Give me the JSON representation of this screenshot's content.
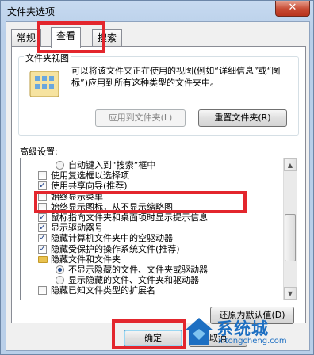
{
  "window": {
    "title": "文件夹选项",
    "close_glyph": "✕"
  },
  "tabs": [
    {
      "label": "常规",
      "active": false
    },
    {
      "label": "查看",
      "active": true
    },
    {
      "label": "搜索",
      "active": false
    }
  ],
  "folder_views": {
    "legend": "文件夹视图",
    "description": "可以将该文件夹正在使用的视图(例如“详细信息”或“图标”)应用到所有这种类型的文件夹中。",
    "apply_button": "应用到文件夹(L)",
    "reset_button": "重置文件夹(R)"
  },
  "advanced": {
    "label": "高级设置:",
    "items": [
      {
        "type": "radio",
        "checked": false,
        "indent": 2,
        "text": "自动键入到“搜索”框中"
      },
      {
        "type": "checkbox",
        "checked": false,
        "indent": 1,
        "text": "使用复选框以选择项"
      },
      {
        "type": "checkbox",
        "checked": true,
        "indent": 1,
        "text": "使用共享向导(推荐)"
      },
      {
        "type": "checkbox",
        "checked": false,
        "indent": 1,
        "text": "始终显示菜单"
      },
      {
        "type": "checkbox",
        "checked": false,
        "indent": 1,
        "text": "始终显示图标，从不显示缩略图"
      },
      {
        "type": "checkbox",
        "checked": true,
        "indent": 1,
        "text": "鼠标指向文件夹和桌面项时显示提示信息"
      },
      {
        "type": "checkbox",
        "checked": true,
        "indent": 1,
        "text": "显示驱动器号"
      },
      {
        "type": "checkbox",
        "checked": true,
        "indent": 1,
        "text": "隐藏计算机文件夹中的空驱动器"
      },
      {
        "type": "checkbox",
        "checked": true,
        "indent": 1,
        "text": "隐藏受保护的操作系统文件(推荐)"
      },
      {
        "type": "folder",
        "checked": false,
        "indent": 1,
        "text": "隐藏文件和文件夹"
      },
      {
        "type": "radio",
        "checked": true,
        "indent": 2,
        "text": "不显示隐藏的文件、文件夹或驱动器"
      },
      {
        "type": "radio",
        "checked": false,
        "indent": 2,
        "text": "显示隐藏的文件、文件夹和驱动器"
      },
      {
        "type": "checkbox",
        "checked": false,
        "indent": 1,
        "text": "隐藏已知文件类型的扩展名"
      }
    ],
    "restore_button": "还原为默认值(D)"
  },
  "footer": {
    "ok_button": "确定",
    "cancel_button": "取消"
  },
  "watermark": {
    "brand": "系统城",
    "url": "xitongcheng.com"
  },
  "colors": {
    "highlight": "#e3262d",
    "brand_blue": "#1d6fc2"
  }
}
